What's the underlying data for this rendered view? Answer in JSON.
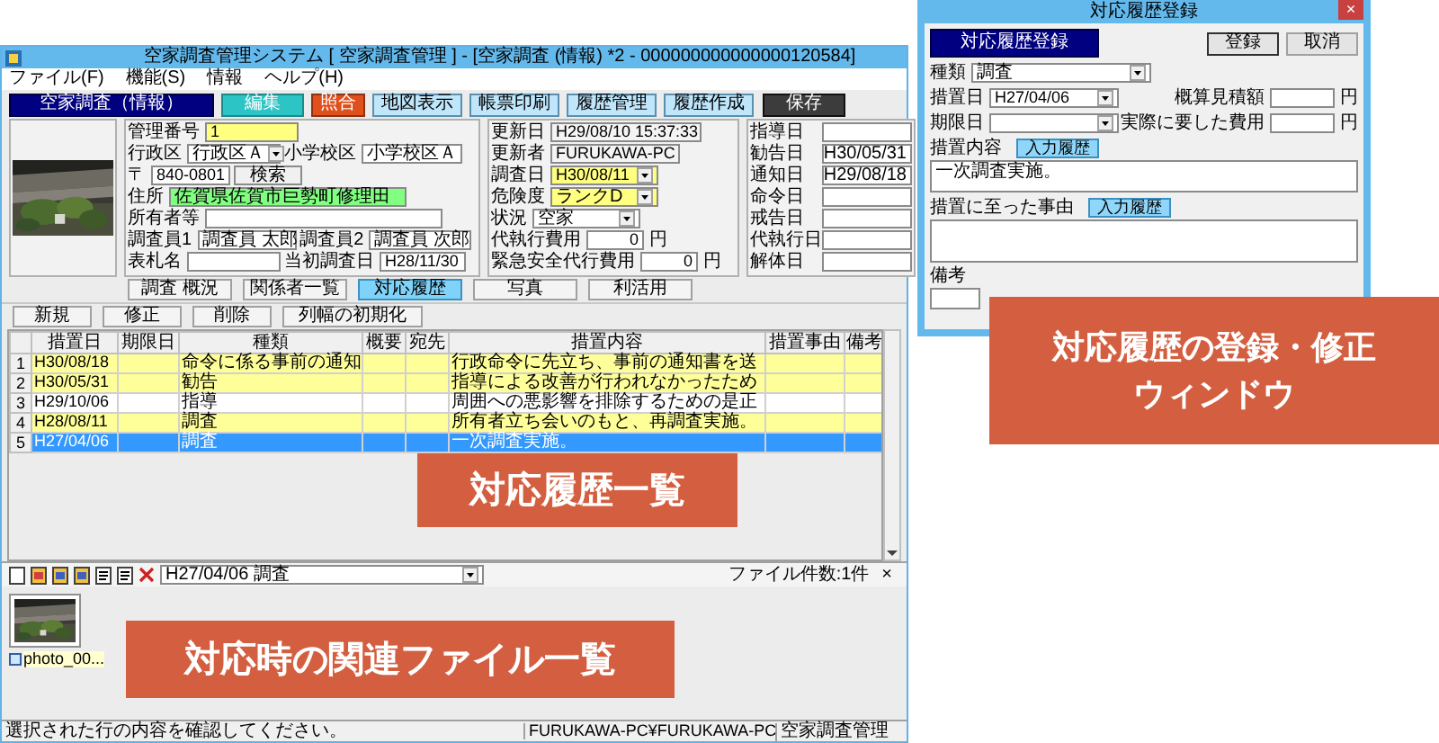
{
  "main_window": {
    "title": "空家調査管理システム [ 空家調査管理 ] - [空家調査 (情報) *2 - 000000000000000120584]",
    "menu": [
      "ファイル(F)",
      "機能(S)",
      "情報",
      "ヘルプ(H)"
    ],
    "toolbar": [
      {
        "label": "空家調査（情報）",
        "kind": "header"
      },
      {
        "label": "編集",
        "kind": "mode"
      },
      {
        "label": "照合",
        "kind": "alert"
      },
      {
        "label": "地図表示",
        "kind": "normal"
      },
      {
        "label": "帳票印刷",
        "kind": "normal"
      },
      {
        "label": "履歴管理",
        "kind": "normal"
      },
      {
        "label": "履歴作成",
        "kind": "normal"
      },
      {
        "label": "保存",
        "kind": "dark"
      }
    ],
    "form": {
      "left": [
        [
          {
            "label": "管理番号",
            "value": "1",
            "kind": "text",
            "color": "#ffff80"
          }
        ],
        [
          {
            "label": "行政区",
            "value": "行政区Ａ",
            "kind": "select"
          },
          {
            "label": "小学校区",
            "value": "小学校区Ａ",
            "kind": "text"
          }
        ],
        [
          {
            "label": "〒",
            "value": "840-0801",
            "kind": "text"
          },
          {
            "label": "検索",
            "kind": "button"
          }
        ],
        [
          {
            "label": "住所",
            "value": "佐賀県佐賀市巨勢町修理田",
            "kind": "wide",
            "color": "#80ff80"
          }
        ],
        [
          {
            "label": "所有者等",
            "kind": "wide"
          }
        ],
        [
          {
            "label": "調査員1",
            "value": "調査員 太郎",
            "kind": "text"
          },
          {
            "label": "調査員2",
            "value": "調査員 次郎",
            "kind": "text"
          }
        ],
        [
          {
            "label": "表札名",
            "kind": "text"
          },
          {
            "label": "当初調査日",
            "value": "H28/11/30",
            "kind": "text"
          }
        ]
      ],
      "middle": [
        {
          "label": "更新日",
          "value": "H29/08/10 15:37:33",
          "kind": "readonly"
        },
        {
          "label": "更新者",
          "value": "FURUKAWA-PC",
          "kind": "readonly"
        },
        {
          "label": "調査日",
          "value": "H30/08/11",
          "kind": "select",
          "color": "#ffff80"
        },
        {
          "label": "危険度",
          "value": "ランクD",
          "kind": "select",
          "color": "#ffff80"
        },
        {
          "label": "状況",
          "value": "空家",
          "kind": "select"
        },
        {
          "label": "代執行費用",
          "value": "0",
          "unit": "円",
          "kind": "money"
        },
        {
          "label": "緊急安全代行費用",
          "value": "0",
          "unit": "円",
          "kind": "money"
        }
      ],
      "right": [
        {
          "label": "指導日"
        },
        {
          "label": "勧告日",
          "value": "H30/05/31"
        },
        {
          "label": "通知日",
          "value": "H29/08/18"
        },
        {
          "label": "命令日"
        },
        {
          "label": "戒告日"
        },
        {
          "label": "代執行日"
        },
        {
          "label": "解体日"
        }
      ]
    },
    "tabs": [
      {
        "label": "調査 概況",
        "selected": false
      },
      {
        "label": "関係者一覧",
        "selected": false
      },
      {
        "label": "対応履歴",
        "selected": true
      },
      {
        "label": "写真",
        "selected": false
      },
      {
        "label": "利活用",
        "selected": false
      }
    ],
    "actions": [
      "新規",
      "修正",
      "削除",
      "列幅の初期化"
    ],
    "table": {
      "columns": [
        "措置日",
        "期限日",
        "種類",
        "概要",
        "宛先",
        "措置内容",
        "措置事由",
        "備考"
      ],
      "rows": [
        {
          "number": "1",
          "cells": [
            "H30/08/18",
            "",
            "命令に係る事前の通知",
            "",
            "",
            "行政命令に先立ち、事前の通知書を送",
            "",
            ""
          ],
          "highlighted": true,
          "selected": false
        },
        {
          "number": "2",
          "cells": [
            "H30/05/31",
            "",
            "勧告",
            "",
            "",
            "指導による改善が行われなかったため",
            "",
            ""
          ],
          "highlighted": true,
          "selected": false
        },
        {
          "number": "3",
          "cells": [
            "H29/10/06",
            "",
            "指導",
            "",
            "",
            "周囲への悪影響を排除するための是正",
            "",
            ""
          ],
          "highlighted": false,
          "selected": false
        },
        {
          "number": "4",
          "cells": [
            "H28/08/11",
            "",
            "調査",
            "",
            "",
            "所有者立ち会いのもと、再調査実施。",
            "",
            ""
          ],
          "highlighted": true,
          "selected": false
        },
        {
          "number": "5",
          "cells": [
            "H27/04/06",
            "",
            "調査",
            "",
            "",
            "一次調査実施。",
            "",
            ""
          ],
          "selected": true
        }
      ]
    },
    "files": {
      "history": "H27/04/06 調査",
      "count": "ファイル件数:1件",
      "close": "×",
      "items": [
        {
          "name": "photo_00..."
        }
      ]
    },
    "status_bar": [
      "選択された行の内容を確認してください。",
      "FURUKAWA-PC¥FURUKAWA-PC",
      "空家調査管理"
    ]
  },
  "dialog": {
    "title": "対応履歴登録",
    "close": "×",
    "header": "対応履歴登録",
    "buttons": [
      "登録",
      "取消"
    ],
    "type": {
      "label": "種類",
      "value": "調査"
    },
    "date": {
      "label": "措置日",
      "value": "H27/04/06"
    },
    "deadline": {
      "label": "期限日"
    },
    "estimate": {
      "label": "概算見積額",
      "unit": "円"
    },
    "actual_cost": {
      "label": "実際に要した費用",
      "unit": "円"
    },
    "content": {
      "label": "措置内容",
      "history_button": "入力履歴",
      "value": "一次調査実施。"
    },
    "reason": {
      "label": "措置に至った事由",
      "history_button": "入力履歴"
    },
    "remarks": {
      "label": "備考"
    }
  },
  "callouts": [
    {
      "lines": [
        "対応履歴の登録・修正",
        "ウィンドウ"
      ]
    },
    {
      "lines": [
        "対応履歴一覧"
      ]
    },
    {
      "lines": [
        "対応時の関連ファイル一覧"
      ]
    }
  ]
}
